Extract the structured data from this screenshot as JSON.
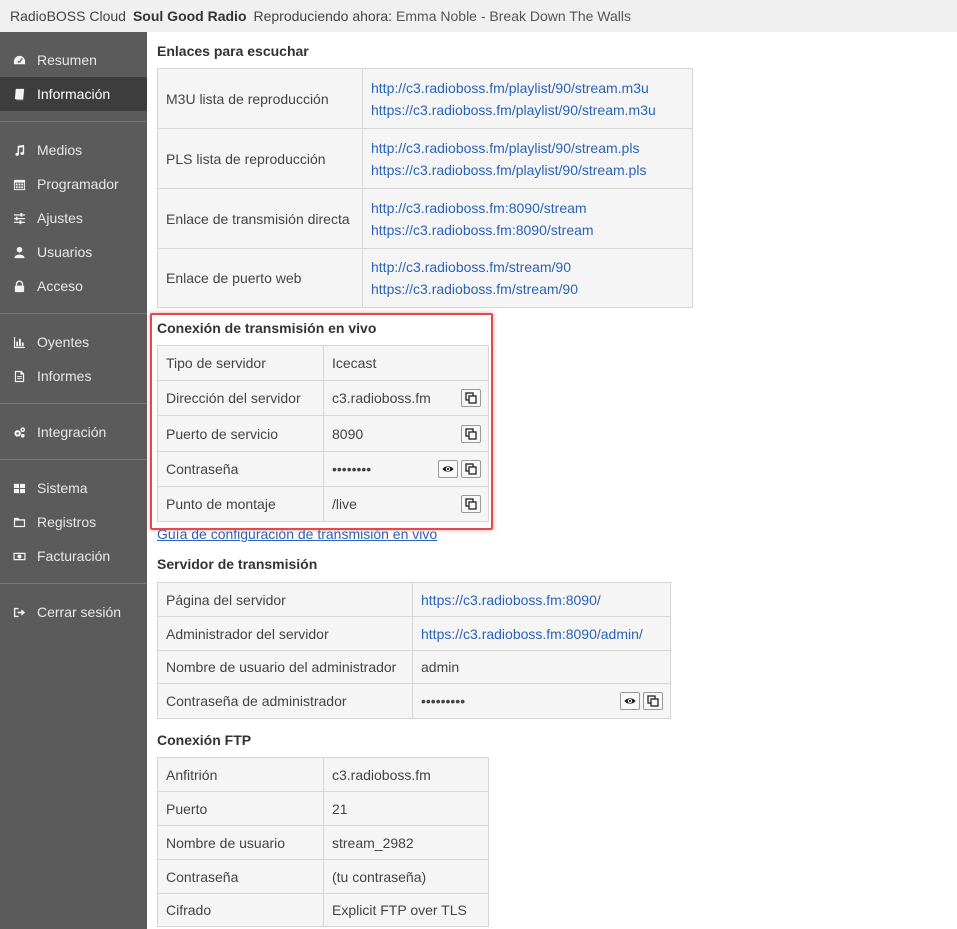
{
  "topbar": {
    "app_name": "RadioBOSS Cloud",
    "station": "Soul Good Radio",
    "now_playing_label": "Reproduciendo ahora:",
    "now_playing": "Emma Noble - Break Down The Walls"
  },
  "sidebar": {
    "items": [
      {
        "label": "Resumen",
        "icon": "dashboard-icon"
      },
      {
        "label": "Información",
        "icon": "book-icon"
      },
      {
        "label": "Medios",
        "icon": "music-icon"
      },
      {
        "label": "Programador",
        "icon": "calendar-icon"
      },
      {
        "label": "Ajustes",
        "icon": "sliders-icon"
      },
      {
        "label": "Usuarios",
        "icon": "user-icon"
      },
      {
        "label": "Acceso",
        "icon": "lock-icon"
      },
      {
        "label": "Oyentes",
        "icon": "bar-chart-icon"
      },
      {
        "label": "Informes",
        "icon": "document-icon"
      },
      {
        "label": "Integración",
        "icon": "cogs-icon"
      },
      {
        "label": "Sistema",
        "icon": "grid-icon"
      },
      {
        "label": "Registros",
        "icon": "folder-icon"
      },
      {
        "label": "Facturación",
        "icon": "money-icon"
      },
      {
        "label": "Cerrar sesión",
        "icon": "sign-out-icon"
      }
    ]
  },
  "listen_links": {
    "title": "Enlaces para escuchar",
    "rows": [
      {
        "label": "M3U lista de reproducción",
        "links": [
          "http://c3.radioboss.fm/playlist/90/stream.m3u",
          "https://c3.radioboss.fm/playlist/90/stream.m3u"
        ]
      },
      {
        "label": "PLS lista de reproducción",
        "links": [
          "http://c3.radioboss.fm/playlist/90/stream.pls",
          "https://c3.radioboss.fm/playlist/90/stream.pls"
        ]
      },
      {
        "label": "Enlace de transmisión directa",
        "links": [
          "http://c3.radioboss.fm:8090/stream",
          "https://c3.radioboss.fm:8090/stream"
        ]
      },
      {
        "label": "Enlace de puerto web",
        "links": [
          "http://c3.radioboss.fm/stream/90",
          "https://c3.radioboss.fm/stream/90"
        ]
      }
    ]
  },
  "live": {
    "title": "Conexión de transmisión en vivo",
    "rows": [
      {
        "label": "Tipo de servidor",
        "value": "Icecast"
      },
      {
        "label": "Dirección del servidor",
        "value": "c3.radioboss.fm"
      },
      {
        "label": "Puerto de servicio",
        "value": "8090"
      },
      {
        "label": "Contraseña",
        "value": "••••••••"
      },
      {
        "label": "Punto de montaje",
        "value": "/live"
      }
    ],
    "guide_link": "Guía de configuración de transmisión en vivo"
  },
  "server": {
    "title": "Servidor de transmisión",
    "rows": [
      {
        "label": "Página del servidor",
        "value": "https://c3.radioboss.fm:8090/"
      },
      {
        "label": "Administrador del servidor",
        "value": "https://c3.radioboss.fm:8090/admin/"
      },
      {
        "label": "Nombre de usuario del administrador",
        "value": "admin"
      },
      {
        "label": "Contraseña de administrador",
        "value": "•••••••••"
      }
    ]
  },
  "ftp": {
    "title": "Conexión FTP",
    "rows": [
      {
        "label": "Anfitrión",
        "value": "c3.radioboss.fm"
      },
      {
        "label": "Puerto",
        "value": "21"
      },
      {
        "label": "Nombre de usuario",
        "value": "stream_2982"
      },
      {
        "label": "Contraseña",
        "value": "(tu contraseña)"
      },
      {
        "label": "Cifrado",
        "value": "Explicit FTP over TLS"
      }
    ]
  },
  "colors": {
    "link": "#2a63b8",
    "sidebar_bg": "#5b5b5b",
    "sidebar_active": "#3d3d3d",
    "highlight": "#e14b4b"
  }
}
